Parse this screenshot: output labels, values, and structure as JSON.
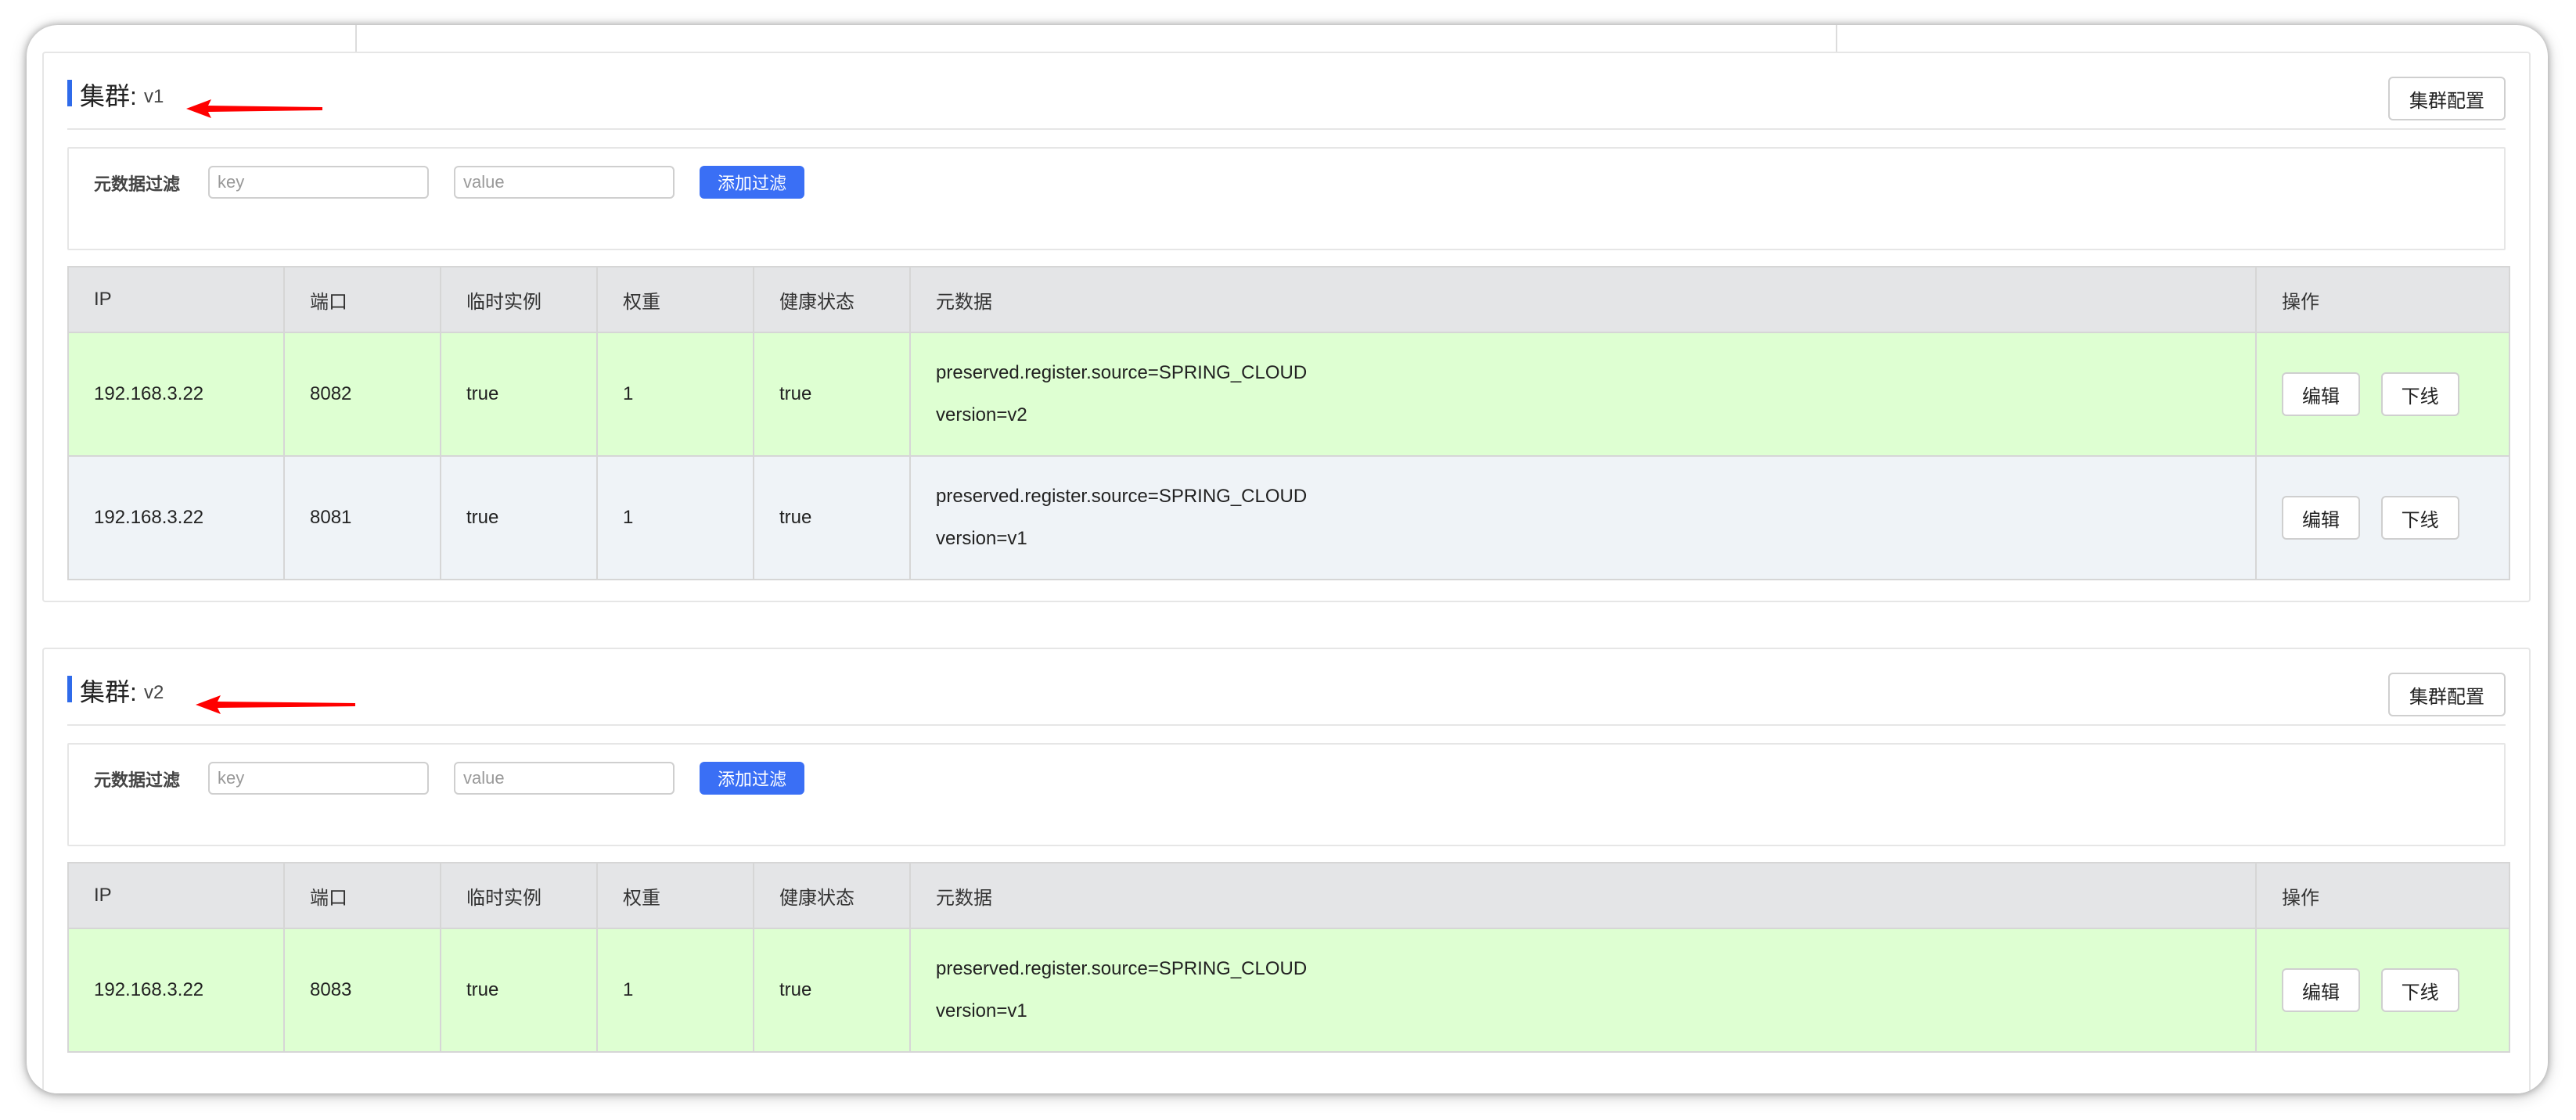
{
  "clusters": [
    {
      "title_label": "集群:",
      "name": "v1",
      "config_button": "集群配置",
      "filter": {
        "label": "元数据过滤",
        "key_placeholder": "key",
        "value_placeholder": "value",
        "add_button": "添加过滤"
      },
      "columns": [
        "IP",
        "端口",
        "临时实例",
        "权重",
        "健康状态",
        "元数据",
        "操作"
      ],
      "rows": [
        {
          "ip": "192.168.3.22",
          "port": "8082",
          "ephemeral": "true",
          "weight": "1",
          "healthy": "true",
          "metadata": [
            "preserved.register.source=SPRING_CLOUD",
            "version=v2"
          ],
          "edit": "编辑",
          "offline": "下线"
        },
        {
          "ip": "192.168.3.22",
          "port": "8081",
          "ephemeral": "true",
          "weight": "1",
          "healthy": "true",
          "metadata": [
            "preserved.register.source=SPRING_CLOUD",
            "version=v1"
          ],
          "edit": "编辑",
          "offline": "下线"
        }
      ]
    },
    {
      "title_label": "集群:",
      "name": "v2",
      "config_button": "集群配置",
      "filter": {
        "label": "元数据过滤",
        "key_placeholder": "key",
        "value_placeholder": "value",
        "add_button": "添加过滤"
      },
      "columns": [
        "IP",
        "端口",
        "临时实例",
        "权重",
        "健康状态",
        "元数据",
        "操作"
      ],
      "rows": [
        {
          "ip": "192.168.3.22",
          "port": "8083",
          "ephemeral": "true",
          "weight": "1",
          "healthy": "true",
          "metadata": [
            "preserved.register.source=SPRING_CLOUD",
            "version=v1"
          ],
          "edit": "编辑",
          "offline": "下线"
        }
      ]
    }
  ],
  "colors": {
    "accent": "#2f6bea",
    "add_button": "#3a6ff5",
    "row_healthy_green": "#deffd2",
    "row_alt_gray": "#eff3f7",
    "annotation_arrow": "#ff0000"
  },
  "icons": {
    "annotation": "red-arrow-icon"
  }
}
